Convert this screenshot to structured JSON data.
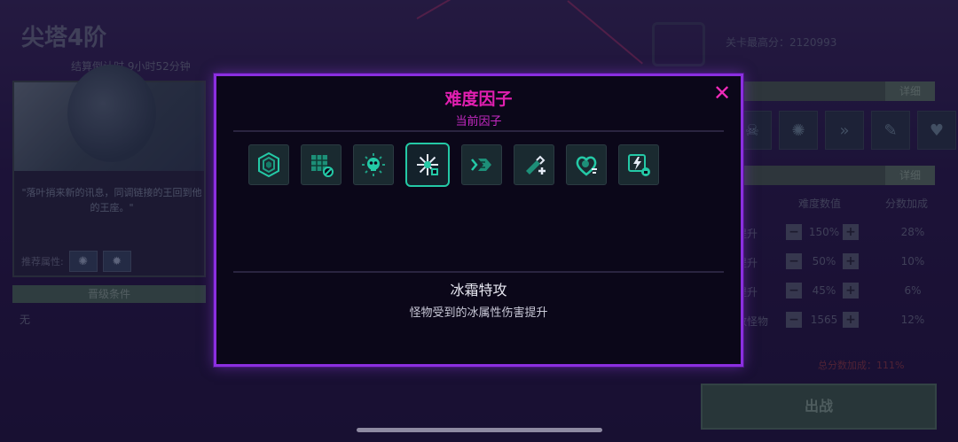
{
  "background": {
    "tower_title": "尖塔4阶",
    "countdown": "结算倒计时 9小时52分钟",
    "boss_quote": "\"落叶捎来新的讯息，同调链接的王回到他的王座。\"",
    "recommend_attr_label": "推荐属性:",
    "upgrade_condition_label": "晋级条件",
    "upgrade_condition_value": "无",
    "max_score": "关卡最高分：2120993",
    "detail_label": "详细",
    "col_difficulty": "难度数值",
    "col_score_bonus": "分数加成",
    "rows": [
      {
        "name": "提升",
        "value": "150%",
        "bonus": "28%"
      },
      {
        "name": "提升",
        "value": "50%",
        "bonus": "10%"
      },
      {
        "name": "提升",
        "value": "45%",
        "bonus": "6%"
      },
      {
        "name": "数怪物",
        "value": "1565",
        "bonus": "12%"
      }
    ],
    "total_bonus": "总分数加成：111%",
    "deploy_label": "出战",
    "minus": "−",
    "plus": "+"
  },
  "modal": {
    "title": "难度因子",
    "subtitle": "当前因子",
    "close_symbol": "✕",
    "factors": [
      {
        "icon": "hexagon-shield-icon",
        "selected": false
      },
      {
        "icon": "grid-block-icon",
        "selected": false
      },
      {
        "icon": "skull-burst-icon",
        "selected": false
      },
      {
        "icon": "frost-burst-icon",
        "selected": true
      },
      {
        "icon": "forward-arrows-icon",
        "selected": false
      },
      {
        "icon": "syringe-plus-icon",
        "selected": false
      },
      {
        "icon": "heart-shield-icon",
        "selected": false
      },
      {
        "icon": "lightning-shield-icon",
        "selected": false
      }
    ],
    "selected_name": "冰霜特攻",
    "selected_desc": "怪物受到的冰属性伤害提升"
  },
  "colors": {
    "modal_border": "#8b2fe0",
    "title": "#e11fb0",
    "icon_teal": "#24c9a6"
  }
}
